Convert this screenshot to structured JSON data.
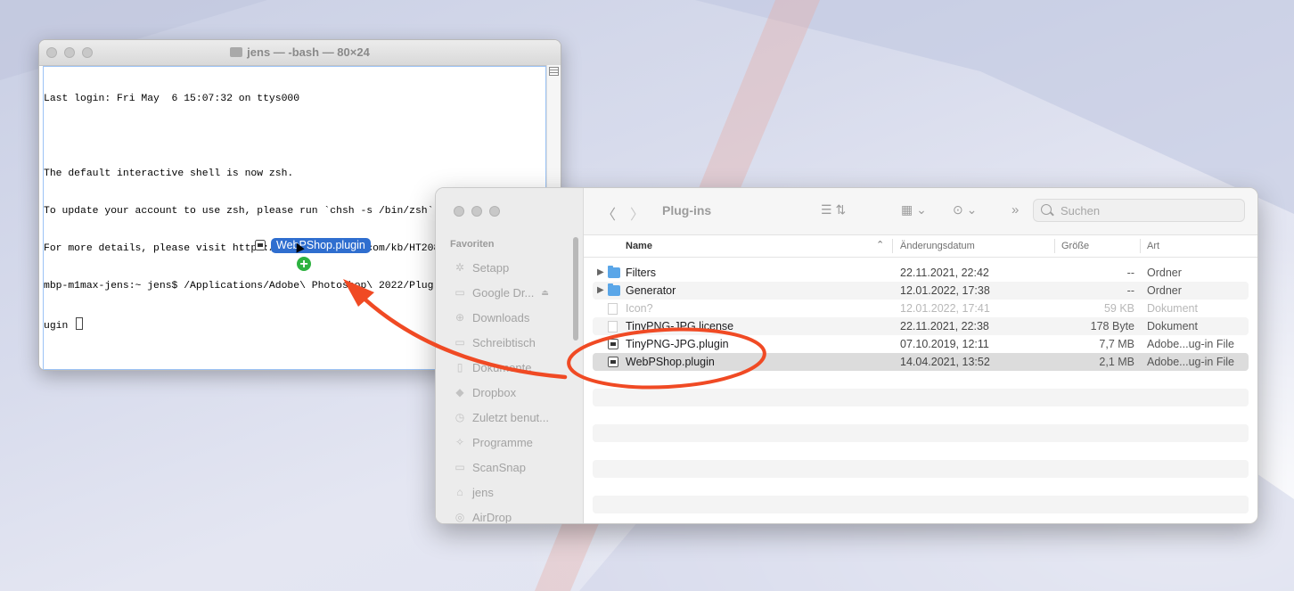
{
  "terminal": {
    "title": "jens — -bash — 80×24",
    "lines": [
      "Last login: Fri May  6 15:07:32 on ttys000",
      "",
      "The default interactive shell is now zsh.",
      "To update your account to use zsh, please run `chsh -s /bin/zsh`.",
      "For more details, please visit https://support.apple.com/kb/HT208050.",
      "mbp-m1max-jens:~ jens$ /Applications/Adobe\\ Photoshop\\ 2022/Plug-ins/WebPShop.pl",
      "ugin "
    ]
  },
  "drag": {
    "label": "WebPShop.plugin",
    "badge": "+"
  },
  "finder": {
    "title": "Plug-ins",
    "search_placeholder": "Suchen",
    "sidebar_heading": "Favoriten",
    "sidebar": [
      {
        "label": "Setapp",
        "icon": "setapp-icon"
      },
      {
        "label": "Google Dr...",
        "icon": "drive-icon",
        "eject": true
      },
      {
        "label": "Downloads",
        "icon": "downloads-icon"
      },
      {
        "label": "Schreibtisch",
        "icon": "desktop-icon"
      },
      {
        "label": "Dokumente",
        "icon": "documents-icon"
      },
      {
        "label": "Dropbox",
        "icon": "dropbox-icon"
      },
      {
        "label": "Zuletzt benut...",
        "icon": "recents-icon"
      },
      {
        "label": "Programme",
        "icon": "applications-icon"
      },
      {
        "label": "ScanSnap",
        "icon": "folder-icon"
      },
      {
        "label": "jens",
        "icon": "home-icon"
      },
      {
        "label": "AirDrop",
        "icon": "airdrop-icon"
      }
    ],
    "columns": {
      "name": "Name",
      "date": "Änderungsdatum",
      "size": "Größe",
      "kind": "Art"
    },
    "rows": [
      {
        "name": "Filters",
        "date": "22.11.2021, 22:42",
        "size": "--",
        "kind": "Ordner",
        "type": "folder"
      },
      {
        "name": "Generator",
        "date": "12.01.2022, 17:38",
        "size": "--",
        "kind": "Ordner",
        "type": "folder"
      },
      {
        "name": "Icon?",
        "date": "12.01.2022, 17:41",
        "size": "59 KB",
        "kind": "Dokument",
        "type": "doc",
        "dim": true
      },
      {
        "name": "TinyPNG-JPG.license",
        "date": "22.11.2021, 22:38",
        "size": "178 Byte",
        "kind": "Dokument",
        "type": "doc"
      },
      {
        "name": "TinyPNG-JPG.plugin",
        "date": "07.10.2019, 12:11",
        "size": "7,7 MB",
        "kind": "Adobe...ug-in File",
        "type": "plugin"
      },
      {
        "name": "WebPShop.plugin",
        "date": "14.04.2021, 13:52",
        "size": "2,1 MB",
        "kind": "Adobe...ug-in File",
        "type": "plugin",
        "selected": true
      }
    ]
  },
  "colors": {
    "annotation": "#f04a24",
    "selection": "#2f6ecf",
    "add_badge": "#2db240",
    "folder": "#5aa6e8"
  }
}
